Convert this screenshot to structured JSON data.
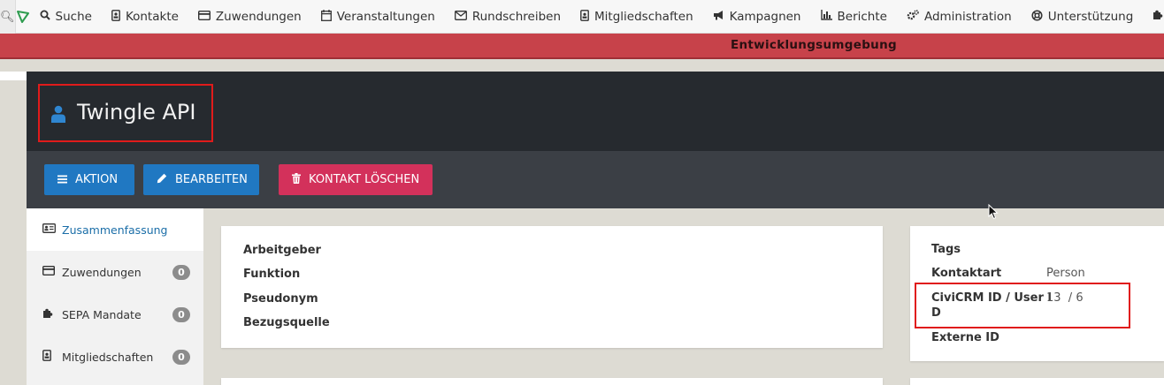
{
  "menubar": {
    "items": [
      {
        "icon": "search-icon",
        "label": "Suche"
      },
      {
        "icon": "contact-card-icon",
        "label": "Kontakte"
      },
      {
        "icon": "credit-card-icon",
        "label": "Zuwendungen"
      },
      {
        "icon": "calendar-icon",
        "label": "Veranstaltungen"
      },
      {
        "icon": "envelope-icon",
        "label": "Rundschreiben"
      },
      {
        "icon": "id-badge-icon",
        "label": "Mitgliedschaften"
      },
      {
        "icon": "bullhorn-icon",
        "label": "Kampagnen"
      },
      {
        "icon": "bar-chart-icon",
        "label": "Berichte"
      },
      {
        "icon": "cogs-icon",
        "label": "Administration"
      },
      {
        "icon": "lifebuoy-icon",
        "label": "Unterstützung"
      }
    ]
  },
  "banner": {
    "text": "Entwicklungsumgebung"
  },
  "contact": {
    "name": "Twingle API"
  },
  "actions": {
    "action_label": "AKTION",
    "edit_label": "BEARBEITEN",
    "delete_label": "KONTAKT LÖSCHEN"
  },
  "tabs": [
    {
      "label": "Zusammenfassung",
      "count": null
    },
    {
      "label": "Zuwendungen",
      "count": "0"
    },
    {
      "label": "SEPA Mandate",
      "count": "0"
    },
    {
      "label": "Mitgliedschaften",
      "count": "0"
    }
  ],
  "summary_panel": {
    "employer_label": "Arbeitgeber",
    "function_label": "Funktion",
    "pseudonym_label": "Pseudonym",
    "source_label": "Bezugsquelle"
  },
  "info_panel": {
    "tags_label": "Tags",
    "contact_type_label": "Kontaktart",
    "contact_type_value": "Person",
    "id_label_line1": "CiviCRM ID / User I",
    "id_label_line2": "D",
    "id_value": "13  / 6",
    "external_id_label": "Externe ID"
  },
  "colors": {
    "banner": "#c7424a",
    "header": "#262a2f",
    "actionbar": "#3b3f45",
    "primary_button": "#2078c2",
    "danger_button": "#d3315b",
    "highlight_box": "#e01b1b"
  }
}
